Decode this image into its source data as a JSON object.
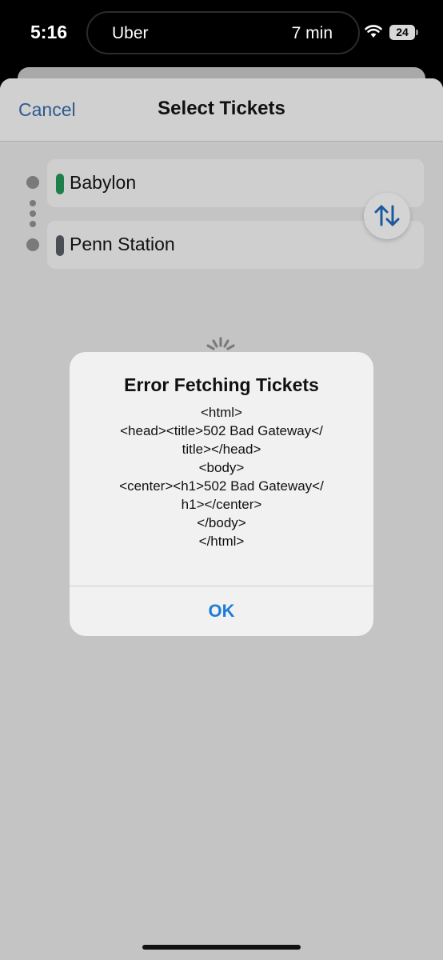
{
  "status_bar": {
    "time": "5:16",
    "app": "Uber",
    "eta": "7 min",
    "battery": "24"
  },
  "nav": {
    "cancel": "Cancel",
    "title": "Select Tickets"
  },
  "route": {
    "origin": {
      "name": "Babylon",
      "color": "#1e7f4a"
    },
    "destination": {
      "name": "Penn Station",
      "color": "#4a4f55"
    },
    "swap_icon": "swap-arrows-icon"
  },
  "alert": {
    "title": "Error Fetching Tickets",
    "lines": [
      "<html>",
      "<head><title>502 Bad Gateway</",
      "title></head>",
      "<body>",
      "<center><h1>502 Bad Gateway</",
      "h1></center>",
      "</body>",
      "</html>"
    ],
    "ok": "OK"
  },
  "colors": {
    "accent": "#1f7cd6",
    "nav_link": "#2d5a8f"
  }
}
